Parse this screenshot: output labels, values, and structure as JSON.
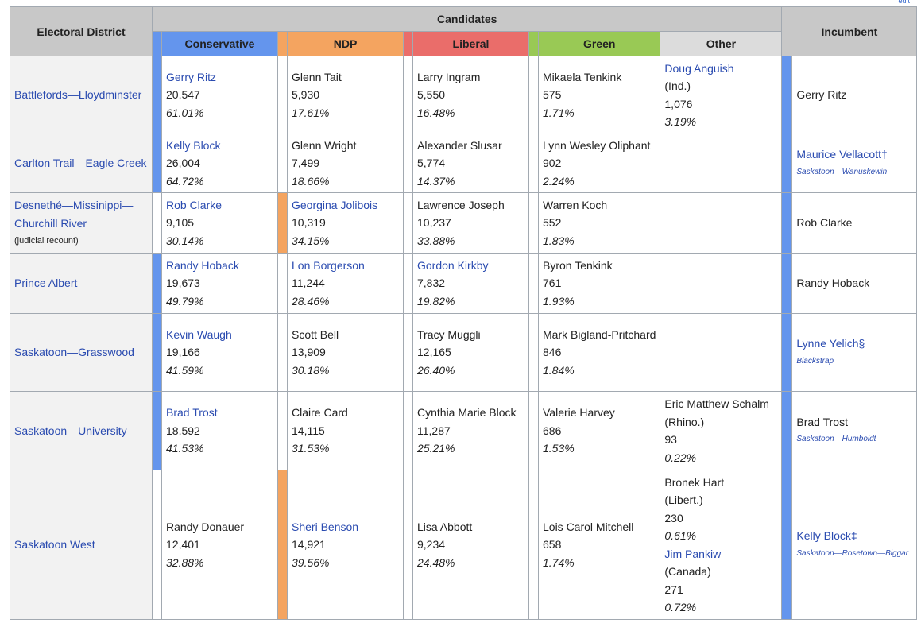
{
  "edit_label": "edit",
  "headers": {
    "district": "Electoral District",
    "candidates": "Candidates",
    "incumbent": "Incumbent",
    "parties": [
      {
        "key": "conservative",
        "label": "Conservative",
        "color": "#6495ed"
      },
      {
        "key": "ndp",
        "label": "NDP",
        "color": "#f4a460"
      },
      {
        "key": "liberal",
        "label": "Liberal",
        "color": "#ea6d6a"
      },
      {
        "key": "green",
        "label": "Green",
        "color": "#99c955"
      },
      {
        "key": "other",
        "label": "Other",
        "color": "#dcdcdc"
      }
    ]
  },
  "rows": [
    {
      "district": {
        "name": "Battlefords—Lloydminster",
        "note": ""
      },
      "winner_strip": "conservative",
      "incumbent_strip": "conservative",
      "conservative": {
        "name": "Gerry Ritz",
        "link": true,
        "votes": "20,547",
        "pct": "61.01%"
      },
      "ndp": {
        "name": "Glenn Tait",
        "link": false,
        "votes": "5,930",
        "pct": "17.61%"
      },
      "liberal": {
        "name": "Larry Ingram",
        "link": false,
        "votes": "5,550",
        "pct": "16.48%"
      },
      "green": {
        "name": "Mikaela Tenkink",
        "link": false,
        "votes": "575",
        "pct": "1.71%"
      },
      "other": [
        {
          "name": "Doug Anguish",
          "link": true,
          "party": "(Ind.)",
          "votes": "1,076",
          "pct": "3.19%"
        }
      ],
      "incumbent": {
        "name": "Gerry Ritz",
        "link": false,
        "riding": ""
      }
    },
    {
      "district": {
        "name": "Carlton Trail—Eagle Creek",
        "note": ""
      },
      "winner_strip": "conservative",
      "incumbent_strip": "conservative",
      "conservative": {
        "name": "Kelly Block",
        "link": true,
        "votes": "26,004",
        "pct": "64.72%"
      },
      "ndp": {
        "name": "Glenn Wright",
        "link": false,
        "votes": "7,499",
        "pct": "18.66%"
      },
      "liberal": {
        "name": "Alexander Slusar",
        "link": false,
        "votes": "5,774",
        "pct": "14.37%"
      },
      "green": {
        "name": "Lynn Wesley Oliphant",
        "link": false,
        "votes": "902",
        "pct": "2.24%"
      },
      "other": [],
      "incumbent": {
        "name": "Maurice Vellacott†",
        "link": true,
        "riding": "Saskatoon—Wanuskewin"
      }
    },
    {
      "district": {
        "name": "Desnethé—Missinippi—Churchill River",
        "note": "(judicial recount)"
      },
      "winner_strip": "ndp",
      "incumbent_strip": "conservative",
      "conservative": {
        "name": "Rob Clarke",
        "link": true,
        "votes": "9,105",
        "pct": "30.14%"
      },
      "ndp": {
        "name": "Georgina Jolibois",
        "link": true,
        "votes": "10,319",
        "pct": "34.15%"
      },
      "liberal": {
        "name": "Lawrence Joseph",
        "link": false,
        "votes": "10,237",
        "pct": "33.88%"
      },
      "green": {
        "name": "Warren Koch",
        "link": false,
        "votes": "552",
        "pct": "1.83%"
      },
      "other": [],
      "incumbent": {
        "name": "Rob Clarke",
        "link": false,
        "riding": ""
      }
    },
    {
      "district": {
        "name": "Prince Albert",
        "note": ""
      },
      "winner_strip": "conservative",
      "incumbent_strip": "conservative",
      "conservative": {
        "name": "Randy Hoback",
        "link": true,
        "votes": "19,673",
        "pct": "49.79%"
      },
      "ndp": {
        "name": "Lon Borgerson",
        "link": true,
        "votes": "11,244",
        "pct": "28.46%"
      },
      "liberal": {
        "name": "Gordon Kirkby",
        "link": true,
        "votes": "7,832",
        "pct": "19.82%"
      },
      "green": {
        "name": "Byron Tenkink",
        "link": false,
        "votes": "761",
        "pct": "1.93%"
      },
      "other": [],
      "incumbent": {
        "name": "Randy Hoback",
        "link": false,
        "riding": ""
      }
    },
    {
      "district": {
        "name": "Saskatoon—Grasswood",
        "note": ""
      },
      "winner_strip": "conservative",
      "incumbent_strip": "conservative",
      "conservative": {
        "name": "Kevin Waugh",
        "link": true,
        "votes": "19,166",
        "pct": "41.59%"
      },
      "ndp": {
        "name": "Scott Bell",
        "link": false,
        "votes": "13,909",
        "pct": "30.18%"
      },
      "liberal": {
        "name": "Tracy Muggli",
        "link": false,
        "votes": "12,165",
        "pct": "26.40%"
      },
      "green": {
        "name": "Mark Bigland-Pritchard",
        "link": false,
        "votes": "846",
        "pct": "1.84%"
      },
      "other": [],
      "incumbent": {
        "name": "Lynne Yelich§",
        "link": true,
        "riding": "Blackstrap"
      }
    },
    {
      "district": {
        "name": "Saskatoon—University",
        "note": ""
      },
      "winner_strip": "conservative",
      "incumbent_strip": "conservative",
      "conservative": {
        "name": "Brad Trost",
        "link": true,
        "votes": "18,592",
        "pct": "41.53%"
      },
      "ndp": {
        "name": "Claire Card",
        "link": false,
        "votes": "14,115",
        "pct": "31.53%"
      },
      "liberal": {
        "name": "Cynthia Marie Block",
        "link": false,
        "votes": "11,287",
        "pct": "25.21%"
      },
      "green": {
        "name": "Valerie Harvey",
        "link": false,
        "votes": "686",
        "pct": "1.53%"
      },
      "other": [
        {
          "name": "Eric Matthew Schalm",
          "link": false,
          "party": "(Rhino.)",
          "votes": "93",
          "pct": "0.22%"
        }
      ],
      "incumbent": {
        "name": "Brad Trost",
        "link": false,
        "riding": "Saskatoon—Humboldt"
      }
    },
    {
      "district": {
        "name": "Saskatoon West",
        "note": ""
      },
      "winner_strip": "ndp",
      "incumbent_strip": "conservative",
      "conservative": {
        "name": "Randy Donauer",
        "link": false,
        "votes": "12,401",
        "pct": "32.88%"
      },
      "ndp": {
        "name": "Sheri Benson",
        "link": true,
        "votes": "14,921",
        "pct": "39.56%"
      },
      "liberal": {
        "name": "Lisa Abbott",
        "link": false,
        "votes": "9,234",
        "pct": "24.48%"
      },
      "green": {
        "name": "Lois Carol Mitchell",
        "link": false,
        "votes": "658",
        "pct": "1.74%"
      },
      "other": [
        {
          "name": "Bronek Hart",
          "link": false,
          "party": "(Libert.)",
          "votes": "230",
          "pct": "0.61%"
        },
        {
          "name": "Jim Pankiw",
          "link": true,
          "party": "(Canada)",
          "votes": "271",
          "pct": "0.72%"
        }
      ],
      "incumbent": {
        "name": "Kelly Block‡",
        "link": true,
        "riding": "Saskatoon—Rosetown—Biggar"
      }
    }
  ]
}
